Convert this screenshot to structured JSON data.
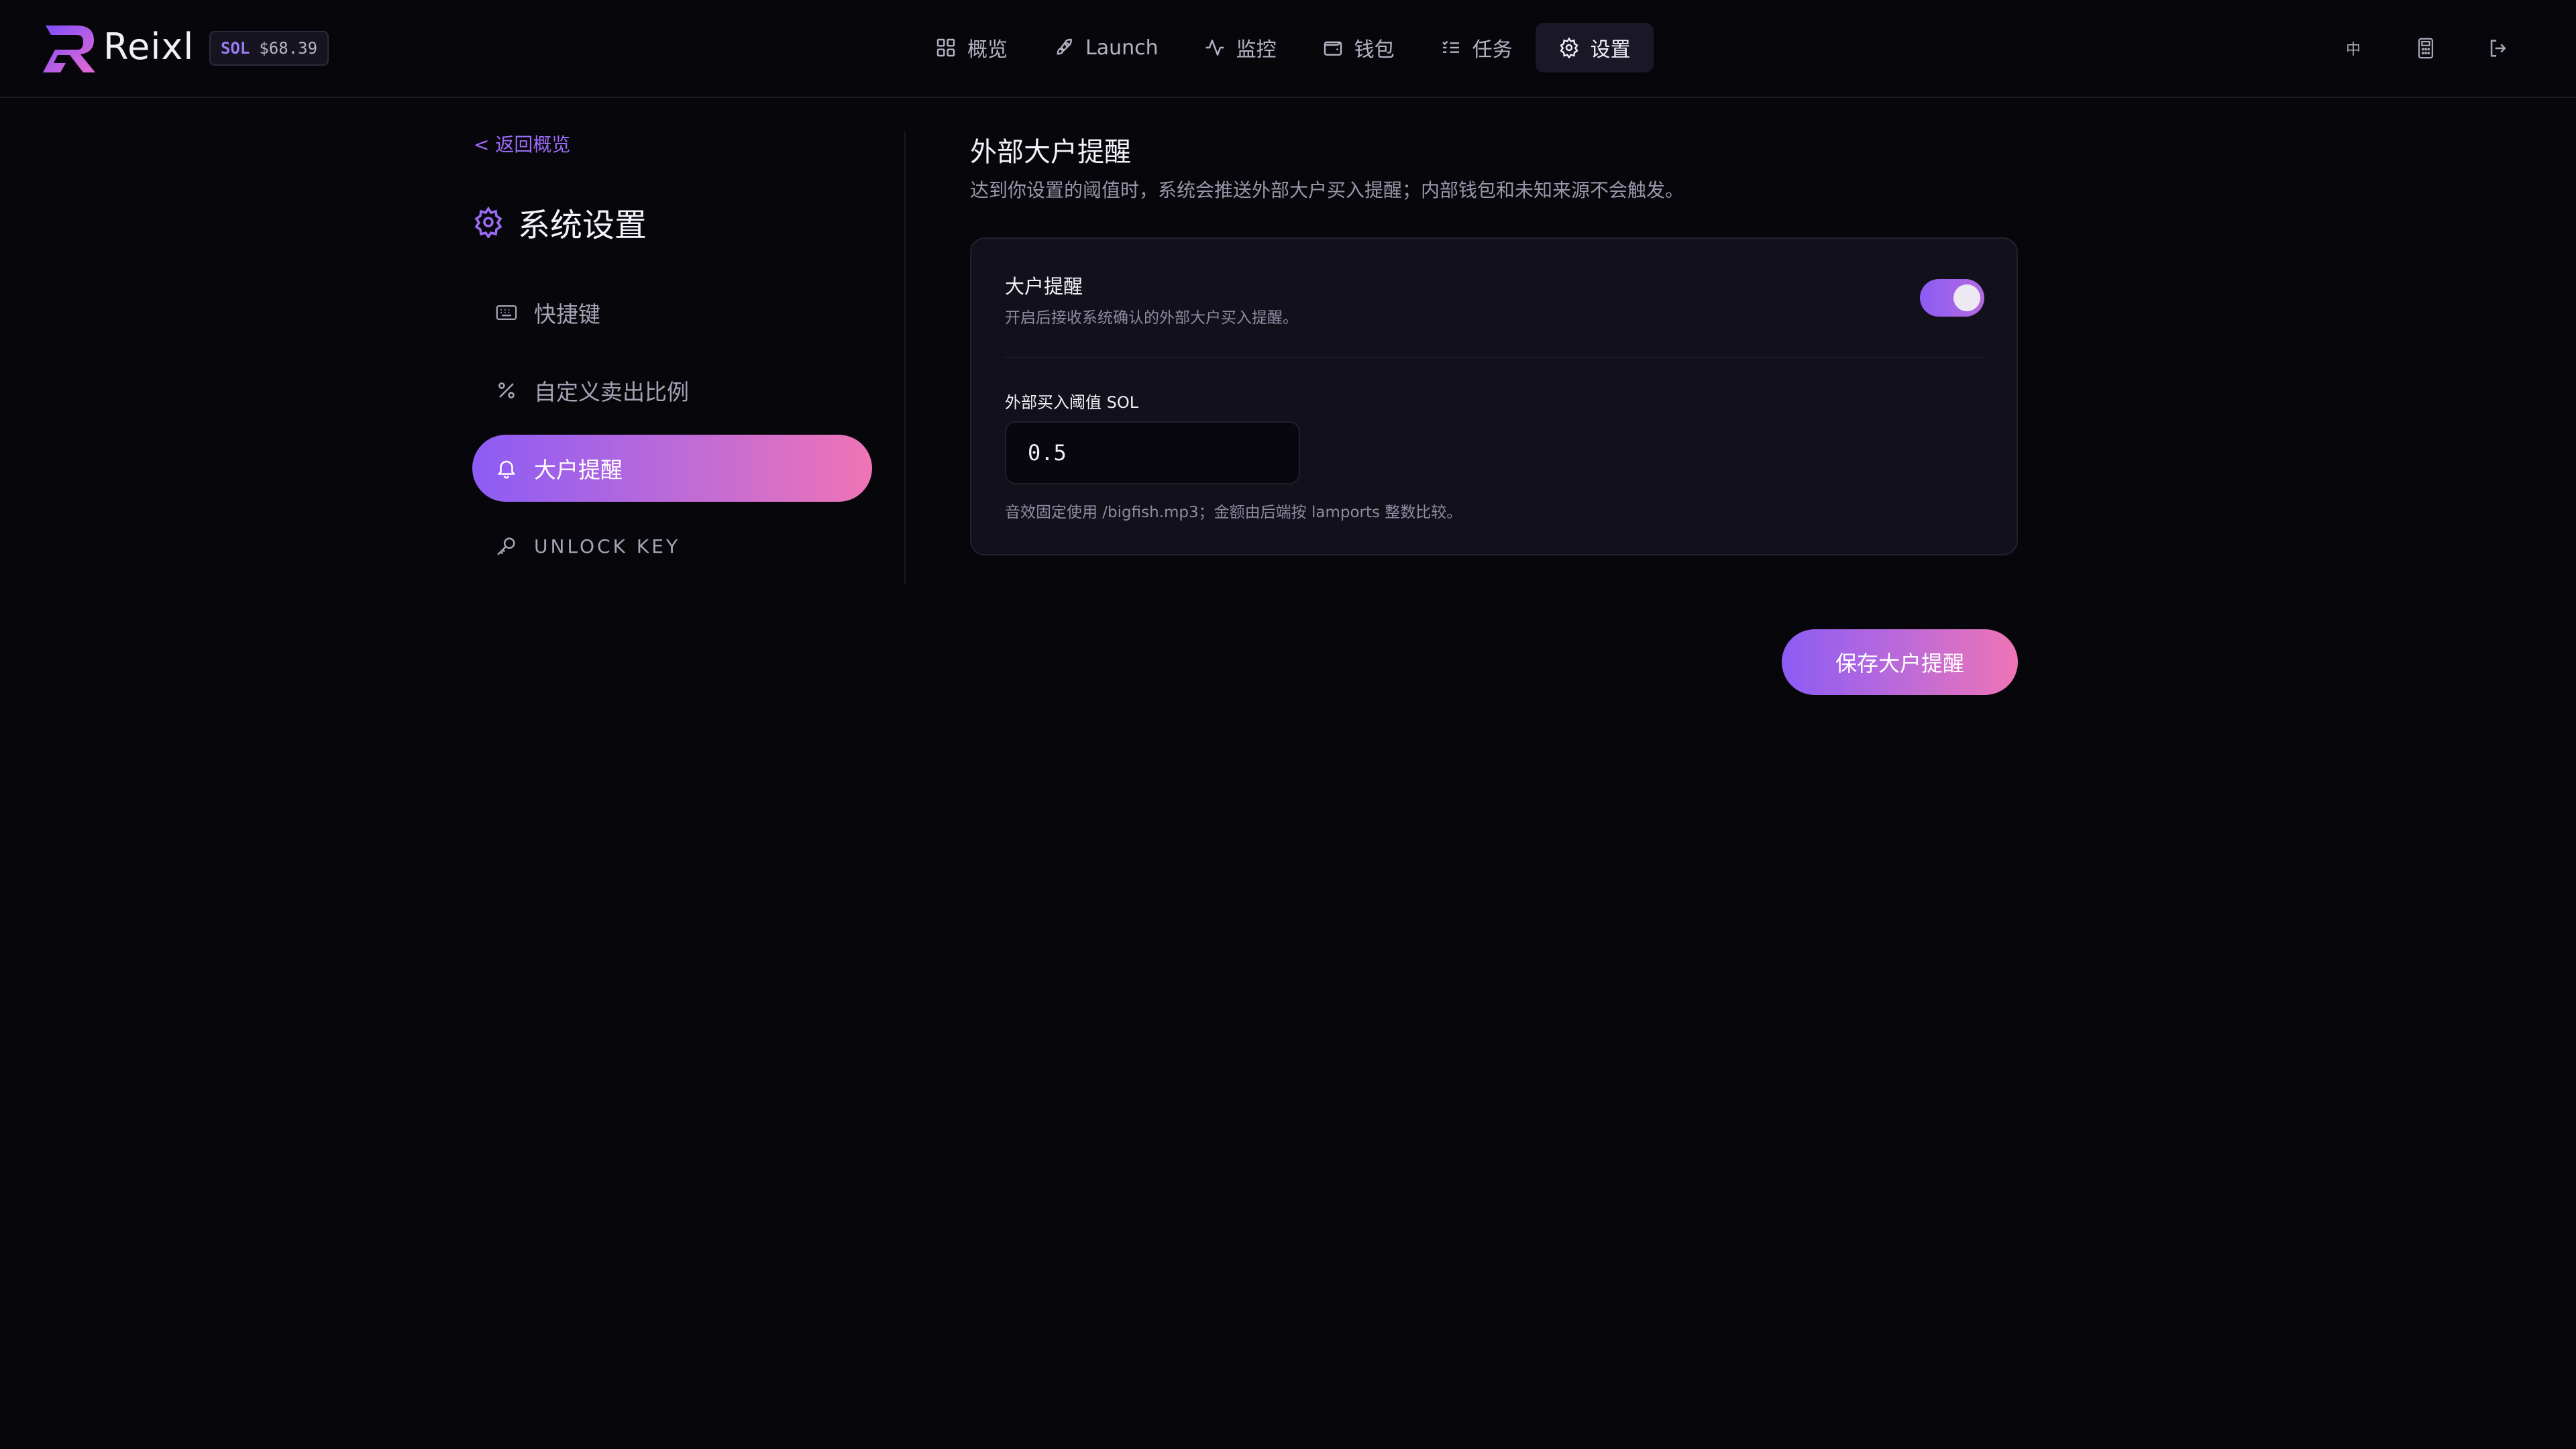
{
  "app": {
    "brand": "Reixl"
  },
  "ticker": {
    "symbol": "SOL",
    "price": "$68.39"
  },
  "nav": {
    "items": [
      {
        "label": "概览",
        "icon": "grid-icon"
      },
      {
        "label": "Launch",
        "icon": "rocket-icon"
      },
      {
        "label": "监控",
        "icon": "pulse-icon"
      },
      {
        "label": "钱包",
        "icon": "wallet-icon"
      },
      {
        "label": "任务",
        "icon": "task-list-icon"
      },
      {
        "label": "设置",
        "icon": "gear-icon",
        "active": true
      }
    ]
  },
  "top_right": {
    "lang": "中",
    "icons": [
      "calculator-icon",
      "logout-icon"
    ]
  },
  "sidebar": {
    "back": "< 返回概览",
    "title": "系统设置",
    "items": [
      {
        "label": "快捷键",
        "icon": "keyboard-icon"
      },
      {
        "label": "自定义卖出比例",
        "icon": "percent-icon"
      },
      {
        "label": "大户提醒",
        "icon": "bell-icon",
        "active": true
      },
      {
        "label": "UNLOCK KEY",
        "icon": "key-icon"
      }
    ]
  },
  "main": {
    "title": "外部大户提醒",
    "description": "达到你设置的阈值时，系统会推送外部大户买入提醒；内部钱包和未知来源不会触发。",
    "toggle_title": "大户提醒",
    "toggle_sub": "开启后接收系统确认的外部大户买入提醒。",
    "toggle_on": true,
    "threshold_label": "外部买入阈值 SOL",
    "threshold_value": "0.5",
    "hint": "音效固定使用 /bigfish.mp3；金额由后端按 lamports 整数比较。",
    "save_label": "保存大户提醒"
  },
  "colors": {
    "accent_start": "#8c5cf5",
    "accent_end": "#ef74b5",
    "background": "#07060b"
  }
}
